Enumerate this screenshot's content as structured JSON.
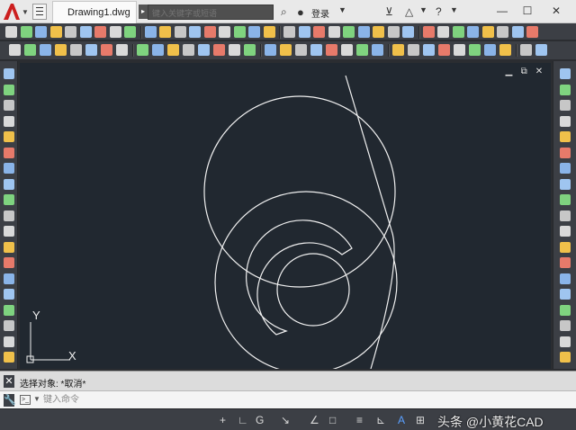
{
  "titlebar": {
    "document_tab": "Drawing1.dwg",
    "search_placeholder": "键入关键字或短语",
    "login_label": "登录",
    "minimize_label": "—",
    "maximize_label": "☐",
    "close_label": "✕"
  },
  "canvas": {
    "background": "#212830",
    "stroke_color": "#f0f0f0",
    "ucs": {
      "y_label": "Y",
      "x_label": "X"
    },
    "viewport_controls": {
      "minimize": "▁",
      "restore": "⧉",
      "close": "✕"
    }
  },
  "command": {
    "history_text": "选择对象: *取消*",
    "input_placeholder": "键入命令",
    "close_label": "✕",
    "wrench_label": "🔧",
    "prompt_label": ">_"
  },
  "statusbar": {
    "items": [
      "+",
      "∟",
      "G",
      "↘",
      "∠",
      "□",
      "≡",
      "⊾",
      "A",
      "⊞",
      "⊕",
      "⊟"
    ]
  },
  "watermark": "头条 @小黄花CAD",
  "colors": {
    "accent_red": "#cc1f1f",
    "toolbar_bg": "#3c3f45",
    "drawing_bg": "#212830",
    "status_active": "#5aa0ff"
  }
}
